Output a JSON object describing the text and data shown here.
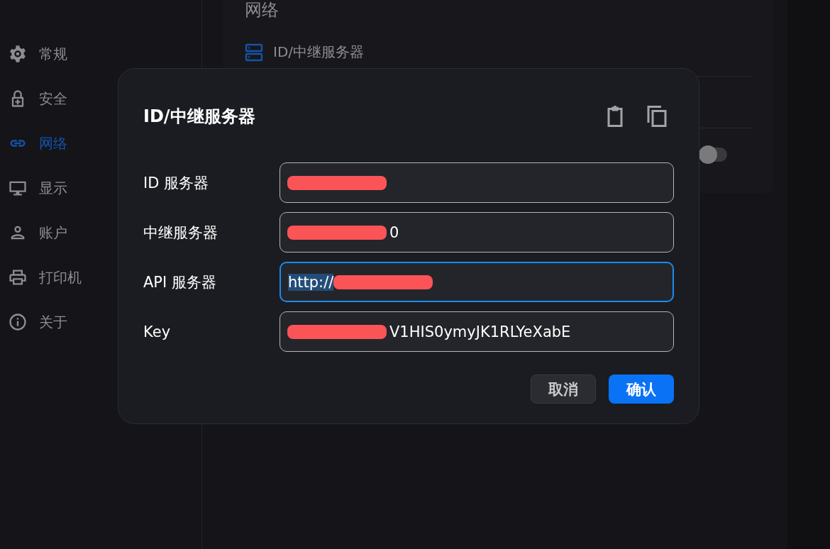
{
  "sidebar": {
    "items": [
      {
        "label": "常规",
        "selected": false
      },
      {
        "label": "安全",
        "selected": false
      },
      {
        "label": "网络",
        "selected": true
      },
      {
        "label": "显示",
        "selected": false
      },
      {
        "label": "账户",
        "selected": false
      },
      {
        "label": "打印机",
        "selected": false
      },
      {
        "label": "关于",
        "selected": false
      }
    ]
  },
  "page": {
    "heading": "网络",
    "setting_label": "ID/中继服务器",
    "toggle_on": false
  },
  "dialog": {
    "title": "ID/中继服务器",
    "fields": [
      {
        "label": "ID 服务器",
        "redacted": true,
        "focused": false
      },
      {
        "label": "中继服务器",
        "value_after": "0",
        "redacted": true,
        "focused": false
      },
      {
        "label": "API 服务器",
        "selected_text": "http://",
        "redacted": true,
        "focused": true
      },
      {
        "label": "Key",
        "value_after": "V1HIS0ymyJK1RLYeXabE",
        "redacted": true,
        "focused": false
      }
    ],
    "buttons": [
      {
        "label": "取消",
        "kind": "secondary"
      },
      {
        "label": "确认",
        "kind": "primary"
      }
    ]
  }
}
